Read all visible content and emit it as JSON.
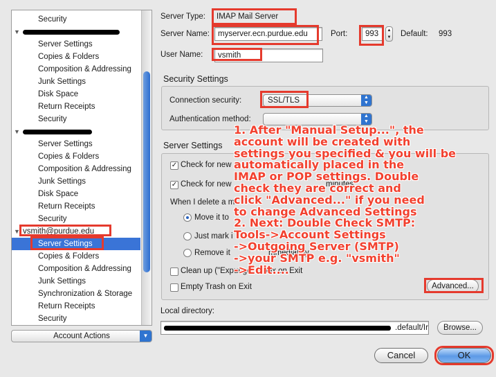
{
  "sidebar": {
    "rows": [
      {
        "label": "Security",
        "type": "item"
      },
      {
        "label": "",
        "type": "account-redacted"
      },
      {
        "label": "Server Settings",
        "type": "item"
      },
      {
        "label": "Copies & Folders",
        "type": "item"
      },
      {
        "label": "Composition & Addressing",
        "type": "item"
      },
      {
        "label": "Junk Settings",
        "type": "item"
      },
      {
        "label": "Disk Space",
        "type": "item"
      },
      {
        "label": "Return Receipts",
        "type": "item"
      },
      {
        "label": "Security",
        "type": "item"
      },
      {
        "label": "",
        "type": "account-redacted"
      },
      {
        "label": "Server Settings",
        "type": "item"
      },
      {
        "label": "Copies & Folders",
        "type": "item"
      },
      {
        "label": "Composition & Addressing",
        "type": "item"
      },
      {
        "label": "Junk Settings",
        "type": "item"
      },
      {
        "label": "Disk Space",
        "type": "item"
      },
      {
        "label": "Return Receipts",
        "type": "item"
      },
      {
        "label": "Security",
        "type": "item"
      },
      {
        "label": "vsmith@purdue.edu",
        "type": "account"
      },
      {
        "label": "Server Settings",
        "type": "item-selected"
      },
      {
        "label": "Copies & Folders",
        "type": "item"
      },
      {
        "label": "Composition & Addressing",
        "type": "item"
      },
      {
        "label": "Junk Settings",
        "type": "item"
      },
      {
        "label": "Synchronization & Storage",
        "type": "item"
      },
      {
        "label": "Return Receipts",
        "type": "item"
      },
      {
        "label": "Security",
        "type": "item"
      }
    ],
    "account_actions_label": "Account Actions"
  },
  "server": {
    "type_label": "Server Type:",
    "type_value": "IMAP Mail Server",
    "name_label": "Server Name:",
    "name_value": "myserver.ecn.purdue.edu",
    "port_label": "Port:",
    "port_value": "993",
    "default_label": "Default:",
    "default_value": "993",
    "user_label": "User Name:",
    "user_value": "vsmith"
  },
  "security": {
    "title": "Security Settings",
    "connection_label": "Connection security:",
    "connection_value": "SSL/TLS",
    "auth_label": "Authentication method:",
    "auth_value": ""
  },
  "server_settings": {
    "title": "Server Settings",
    "check_new_label": "Check for new",
    "check_new_every_label": "Check for new",
    "minutes_label": "minutes",
    "delete_label": "When I delete a m",
    "move_label": "Move it to",
    "just_mark_label": "Just mark i",
    "remove_label": "Remove it",
    "remove_suffix": "mmediately",
    "cleanup_label": "Clean up (\"Expunge\" Inbox on Exit",
    "empty_trash_label": "Empty Trash on Exit",
    "advanced_label": "Advanced..."
  },
  "local_dir": {
    "label": "Local directory:",
    "value_suffix": ".default/Ir",
    "browse_label": "Browse..."
  },
  "buttons": {
    "cancel": "Cancel",
    "ok": "OK"
  },
  "annotation": {
    "lines": [
      "1. After \"Manual Setup...\", the",
      "account will be created with",
      "settings you specified & you will be",
      "automatically placed in the",
      "IMAP or POP settings. Double",
      "check they are correct and",
      "click \"Advanced...\" if you need",
      "to change Advanced Settings",
      "2. Next: Double Check SMTP:",
      "Tools->Account Settings",
      "->Outgoing Server (SMTP)",
      "->your SMTP e.g. \"vsmith\"",
      "->Edit...."
    ]
  },
  "colors": {
    "highlight": "#e53a2d",
    "selection": "#3a74d7",
    "annotation": "#f2412f"
  }
}
